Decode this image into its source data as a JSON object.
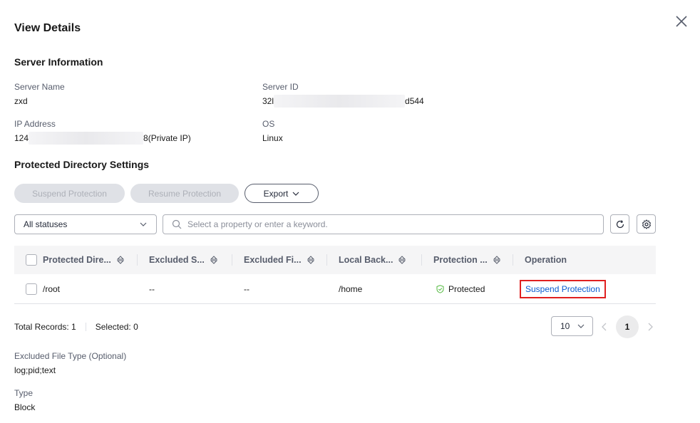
{
  "dialog": {
    "title": "View Details"
  },
  "server_info": {
    "title": "Server Information",
    "server_name_label": "Server Name",
    "server_name": "zxd",
    "server_id_label": "Server ID",
    "server_id_prefix": "32l",
    "server_id_suffix": "d544",
    "ip_label": "IP Address",
    "ip_prefix": "124",
    "ip_suffix": "8(Private IP)",
    "os_label": "OS",
    "os": "Linux"
  },
  "protected_dir": {
    "title": "Protected Directory Settings",
    "buttons": {
      "suspend": "Suspend Protection",
      "resume": "Resume Protection",
      "export": "Export"
    },
    "filter": {
      "status_value": "All statuses",
      "search_placeholder": "Select a property or enter a keyword."
    },
    "table": {
      "columns": [
        "Protected Dire...",
        "Excluded S...",
        "Excluded Fi...",
        "Local Back...",
        "Protection ...",
        "Operation"
      ],
      "rows": [
        {
          "protected_dir": "/root",
          "excluded_sub": "--",
          "excluded_file": "--",
          "local_backup": "/home",
          "status": "Protected",
          "operation": "Suspend Protection"
        }
      ]
    },
    "footer": {
      "total": "Total Records: 1",
      "selected": "Selected: 0",
      "page_size": "10",
      "current_page": "1"
    }
  },
  "extra": {
    "excluded_type_label": "Excluded File Type (Optional)",
    "excluded_type_value": "log;pid;text",
    "type_label": "Type",
    "type_value": "Block"
  },
  "colors": {
    "link": "#0a5bd1",
    "protected": "#50b83c",
    "highlight": "#e02020"
  }
}
